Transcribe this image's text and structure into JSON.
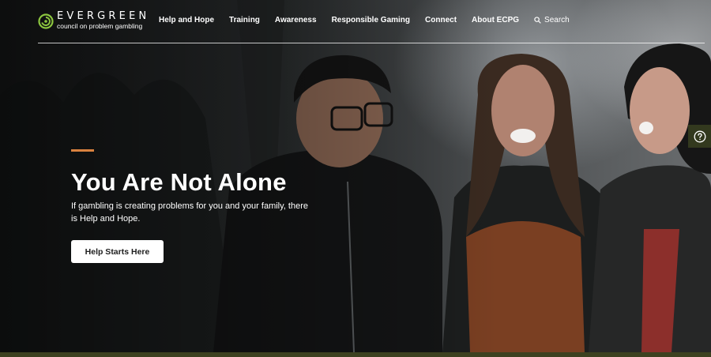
{
  "brand": {
    "name": "EVERGREEN",
    "tagline": "council on problem gambling",
    "accent_color": "#d9823f",
    "logo_color": "#8cc63f"
  },
  "nav": {
    "items": [
      {
        "label": "Help and Hope"
      },
      {
        "label": "Training"
      },
      {
        "label": "Awareness"
      },
      {
        "label": "Responsible Gaming"
      },
      {
        "label": "Connect"
      },
      {
        "label": "About ECPG"
      }
    ],
    "search_label": "Search",
    "search_icon": "search-icon"
  },
  "hero": {
    "headline": "You Are Not Alone",
    "subtext": "If gambling is creating problems for you and your family, there is Help and Hope.",
    "cta_label": "Help Starts Here",
    "image": "three-people-laughing-photo"
  },
  "help_tab": {
    "icon": "question-circle-icon",
    "color": "#33391e"
  }
}
